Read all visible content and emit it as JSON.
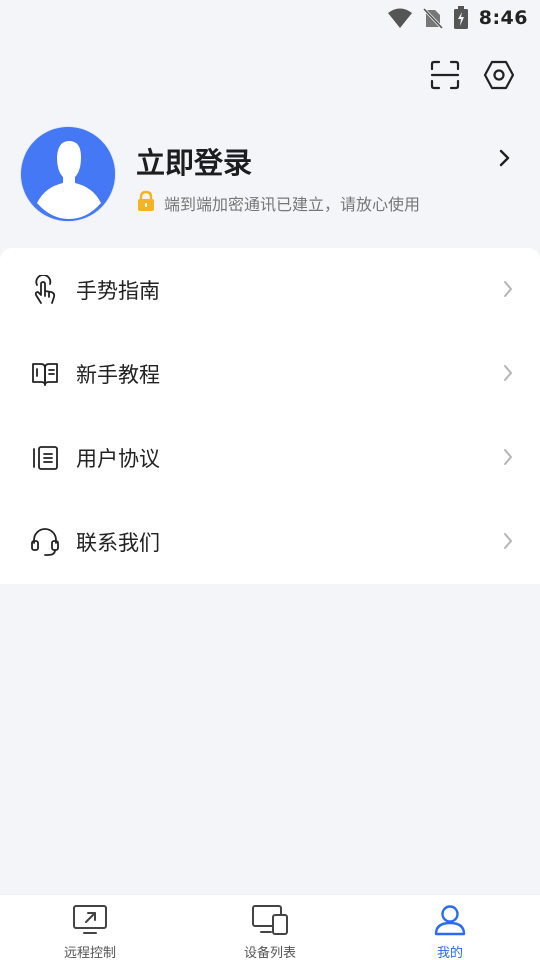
{
  "status_bar": {
    "time": "8:46"
  },
  "profile": {
    "title": "立即登录",
    "secure_text": "端到端加密通讯已建立，请放心使用"
  },
  "menu": [
    {
      "label": "手势指南",
      "icon": "hand-pointer-icon"
    },
    {
      "label": "新手教程",
      "icon": "book-icon"
    },
    {
      "label": "用户协议",
      "icon": "document-icon"
    },
    {
      "label": "联系我们",
      "icon": "headset-icon"
    }
  ],
  "bottom_nav": [
    {
      "label": "远程控制",
      "icon": "remote-desktop-icon",
      "active": false
    },
    {
      "label": "设备列表",
      "icon": "devices-icon",
      "active": false
    },
    {
      "label": "我的",
      "icon": "user-icon",
      "active": true
    }
  ],
  "colors": {
    "accent": "#2a6bf2",
    "avatar_bg": "#4478f5",
    "lock": "#f5b324",
    "page_bg": "#f4f5f9"
  }
}
